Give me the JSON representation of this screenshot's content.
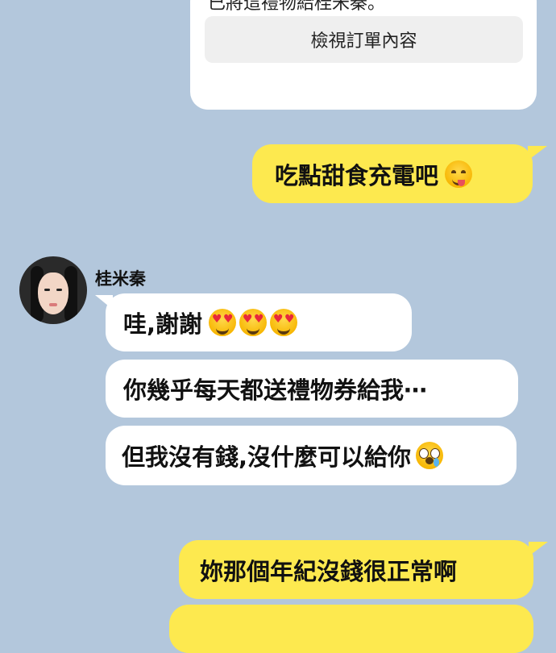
{
  "gift": {
    "message_partial": "已將這禮物給桂米秦。",
    "view_order_button": "檢視訂單內容"
  },
  "contact": {
    "name": "桂米秦"
  },
  "messages": [
    {
      "sender": "me",
      "text": "吃點甜食充電吧",
      "emoji": "face-savoring-food-icon"
    },
    {
      "sender": "contact",
      "text": "哇,謝謝",
      "emoji": "heart-eyes-icon x3"
    },
    {
      "sender": "contact",
      "text": "你幾乎每天都送禮物券給我⋯"
    },
    {
      "sender": "contact",
      "text": "但我沒有錢,沒什麼可以給你",
      "emoji": "pleading-face-icon"
    },
    {
      "sender": "me",
      "text": "妳那個年紀沒錢很正常啊"
    }
  ],
  "colors": {
    "background": "#b3c7dc",
    "my_bubble": "#fde94f",
    "their_bubble": "#ffffff"
  }
}
